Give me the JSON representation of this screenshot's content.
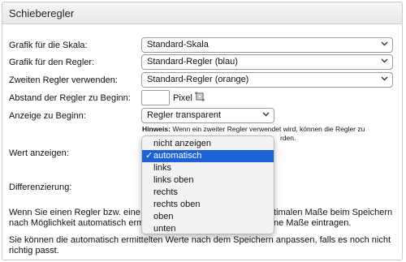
{
  "panel": {
    "title": "Schieberegler"
  },
  "rows": {
    "scale": {
      "label": "Grafik für die Skala:",
      "value": "Standard-Skala"
    },
    "slider": {
      "label": "Grafik für den Regler:",
      "value": "Standard-Regler (blau)"
    },
    "second": {
      "label": "Zweiten Regler verwenden:",
      "value": "Standard-Regler (orange)"
    },
    "distance": {
      "label": "Abstand der Regler zu Beginn:",
      "value": "",
      "unit": "Pixel"
    },
    "display_start": {
      "label": "Anzeige zu Beginn:",
      "value": "Regler transparent"
    },
    "show_value": {
      "label": "Wert anzeigen:"
    },
    "difference": {
      "label": "Differenzierung:"
    }
  },
  "hint": {
    "bold": "Hinweis:",
    "line1": "Wenn ein zweiter Regler verwendet wird, können die Regler zu",
    "line2_end": "rden."
  },
  "para1": {
    "line1_left": "Wenn Sie einen Regler bzw. eine S",
    "line1_right": "timalen Maße beim Speichern",
    "line2_left": "nach Möglichkeit automatisch ermi",
    "line2_right": "ne Maße eintragen."
  },
  "para2": {
    "line1": "Sie können die automatisch ermittelten Werte nach dem Speichern anpassen, falls es noch nicht",
    "line2": "richtig passt."
  },
  "dropdown": {
    "options": [
      "nicht anzeigen",
      "automatisch",
      "links",
      "links oben",
      "rechts",
      "rechts oben",
      "oben",
      "unten"
    ],
    "selected": "automatisch",
    "check_mark": "✓"
  },
  "icons": {
    "chevron": "⌄",
    "pick": "crosshair-grid-icon"
  },
  "colors": {
    "selection": "#1d62d5",
    "header": "#ececec"
  }
}
